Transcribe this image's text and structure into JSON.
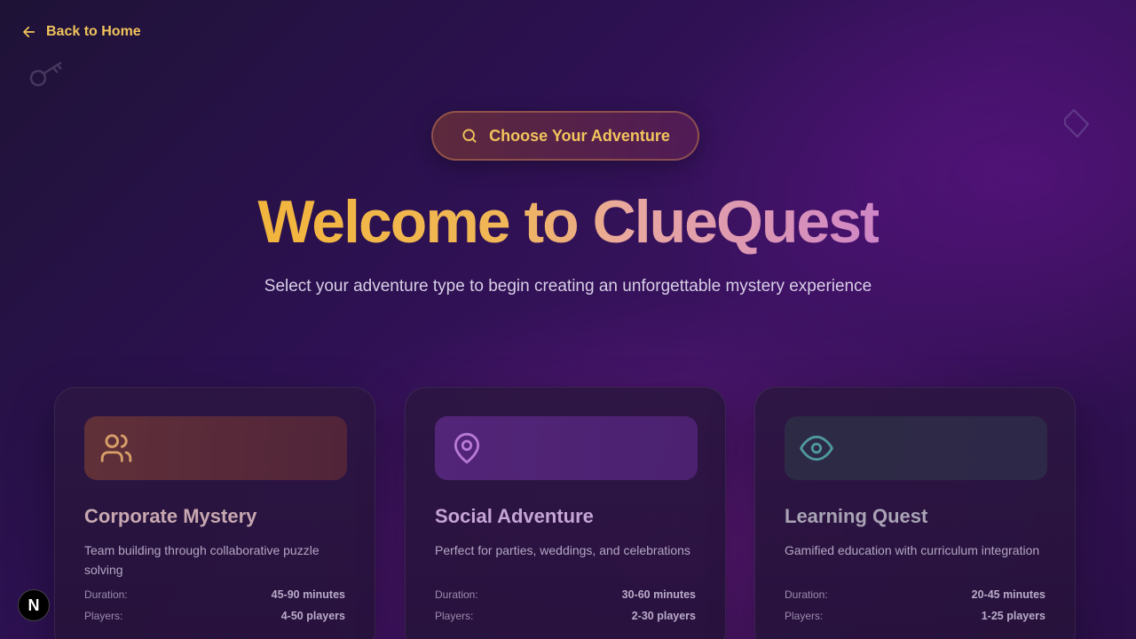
{
  "nav": {
    "back_label": "Back to Home"
  },
  "hero": {
    "badge_label": "Choose Your Adventure",
    "title": "Welcome to ClueQuest",
    "subtitle": "Select your adventure type to begin creating an unforgettable mystery experience"
  },
  "cards": [
    {
      "icon": "users-icon",
      "accent": "#e0a060",
      "title": "Corporate Mystery",
      "description": "Team building through collaborative puzzle solving",
      "duration_label": "Duration:",
      "duration": "45-90 minutes",
      "players_label": "Players:",
      "players": "4-50 players"
    },
    {
      "icon": "map-pin-icon",
      "accent": "#b06ad0",
      "title": "Social Adventure",
      "description": "Perfect for parties, weddings, and celebrations",
      "duration_label": "Duration:",
      "duration": "30-60 minutes",
      "players_label": "Players:",
      "players": "2-30 players"
    },
    {
      "icon": "eye-icon",
      "accent": "#4f9a9e",
      "title": "Learning Quest",
      "description": "Gamified education with curriculum integration",
      "duration_label": "Duration:",
      "duration": "20-45 minutes",
      "players_label": "Players:",
      "players": "1-25 players"
    }
  ],
  "dev_indicator": {
    "label": "N"
  }
}
